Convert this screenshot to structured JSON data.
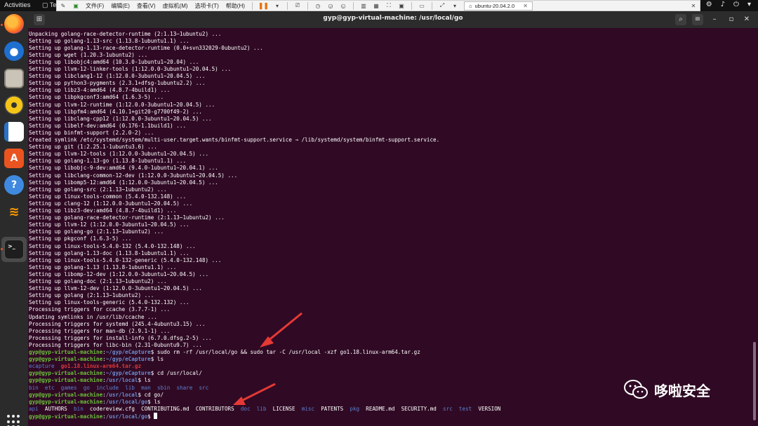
{
  "topbar": {
    "activities": "Activities",
    "terminal_tab": "Te"
  },
  "vmbar": {
    "menus": [
      "文件(F)",
      "编辑(E)",
      "查看(V)",
      "虚拟机(M)",
      "选项卡(T)",
      "帮助(H)"
    ],
    "tab_label": "ubuntu-20.04.2.0"
  },
  "terminal": {
    "title": "gyp@gyp-virtual-machine: /usr/local/go",
    "output_lines": [
      "Unpacking golang-race-detector-runtime (2:1.13~1ubuntu2) ...",
      "Setting up golang-1.13-src (1.13.8-1ubuntu1.1) ...",
      "Setting up golang-1.13-race-detector-runtime (0.0+svn332029-0ubuntu2) ...",
      "Setting up wget (1.20.3-1ubuntu2) ...",
      "Setting up libobjc4:amd64 (10.3.0-1ubuntu1~20.04) ...",
      "Setting up llvm-12-linker-tools (1:12.0.0-3ubuntu1~20.04.5) ...",
      "Setting up libclang1-12 (1:12.0.0-3ubuntu1~20.04.5) ...",
      "Setting up python3-pygments (2.3.1+dfsg-1ubuntu2.2) ...",
      "Setting up libz3-4:amd64 (4.8.7-4build1) ...",
      "Setting up libpkgconf3:amd64 (1.6.3-5) ...",
      "Setting up llvm-12-runtime (1:12.0.0-3ubuntu1~20.04.5) ...",
      "Setting up libpfm4:amd64 (4.10.1+git20-g7700f49-2) ...",
      "Setting up libclang-cpp12 (1:12.0.0-3ubuntu1~20.04.5) ...",
      "Setting up libelf-dev:amd64 (0.176-1.1build1) ...",
      "Setting up binfmt-support (2.2.0-2) ...",
      "Created symlink /etc/systemd/system/multi-user.target.wants/binfmt-support.service → /lib/systemd/system/binfmt-support.service.",
      "Setting up git (1:2.25.1-1ubuntu3.6) ...",
      "Setting up llvm-12-tools (1:12.0.0-3ubuntu1~20.04.5) ...",
      "Setting up golang-1.13-go (1.13.8-1ubuntu1.1) ...",
      "Setting up libobjc-9-dev:amd64 (9.4.0-1ubuntu1~20.04.1) ...",
      "Setting up libclang-common-12-dev (1:12.0.0-3ubuntu1~20.04.5) ...",
      "Setting up libomp5-12:amd64 (1:12.0.0-3ubuntu1~20.04.5) ...",
      "Setting up golang-src (2:1.13~1ubuntu2) ...",
      "Setting up linux-tools-common (5.4.0-132.148) ...",
      "Setting up clang-12 (1:12.0.0-3ubuntu1~20.04.5) ...",
      "Setting up libz3-dev:amd64 (4.8.7-4build1) ...",
      "Setting up golang-race-detector-runtime (2:1.13~1ubuntu2) ...",
      "Setting up llvm-12 (1:12.0.0-3ubuntu1~20.04.5) ...",
      "Setting up golang-go (2:1.13~1ubuntu2) ...",
      "Setting up pkgconf (1.6.3-5) ...",
      "Setting up linux-tools-5.4.0-132 (5.4.0-132.148) ...",
      "Setting up golang-1.13-doc (1.13.8-1ubuntu1.1) ...",
      "Setting up linux-tools-5.4.0-132-generic (5.4.0-132.148) ...",
      "Setting up golang-1.13 (1.13.8-1ubuntu1.1) ...",
      "Setting up libomp-12-dev (1:12.0.0-3ubuntu1~20.04.5) ...",
      "Setting up golang-doc (2:1.13~1ubuntu2) ...",
      "Setting up llvm-12-dev (1:12.0.0-3ubuntu1~20.04.5) ...",
      "Setting up golang (2:1.13~1ubuntu2) ...",
      "Setting up linux-tools-generic (5.4.0-132.132) ...",
      "Processing triggers for ccache (3.7.7-1) ...",
      "Updating symlinks in /usr/lib/ccache ...",
      "Processing triggers for systemd (245.4-4ubuntu3.15) ...",
      "Processing triggers for man-db (2.9.1-1) ...",
      "Processing triggers for install-info (6.7.0.dfsg.2-5) ...",
      "Processing triggers for libc-bin (2.31-0ubuntu9.7) ..."
    ],
    "session": {
      "user_host": "gyp@gyp-virtual-machine",
      "path_ecapture": "~/gyp/eCapture",
      "path_local": "/usr/local",
      "path_go": "/usr/local/go",
      "cmd1": "sudo rm -rf /usr/local/go && sudo tar -C /usr/local -xzf go1.18.linux-arm64.tar.gz",
      "cmd2": "ls",
      "ls1_dir": "ecapture",
      "ls1_archive": "go1.18.linux-arm64.tar.gz",
      "cmd3": "cd /usr/local/",
      "cmd4": "ls",
      "ls2": [
        "bin",
        "etc",
        "games",
        "go",
        "include",
        "lib",
        "man",
        "sbin",
        "share",
        "src"
      ],
      "cmd5": "cd go/",
      "cmd6": "ls",
      "ls3": [
        {
          "name": "api",
          "dir": true
        },
        {
          "name": "AUTHORS",
          "dir": false
        },
        {
          "name": "bin",
          "dir": true
        },
        {
          "name": "codereview.cfg",
          "dir": false
        },
        {
          "name": "CONTRIBUTING.md",
          "dir": false
        },
        {
          "name": "CONTRIBUTORS",
          "dir": false
        },
        {
          "name": "doc",
          "dir": true
        },
        {
          "name": "lib",
          "dir": true
        },
        {
          "name": "LICENSE",
          "dir": false
        },
        {
          "name": "misc",
          "dir": true
        },
        {
          "name": "PATENTS",
          "dir": false
        },
        {
          "name": "pkg",
          "dir": true
        },
        {
          "name": "README.md",
          "dir": false
        },
        {
          "name": "SECURITY.md",
          "dir": false
        },
        {
          "name": "src",
          "dir": true
        },
        {
          "name": "test",
          "dir": true
        },
        {
          "name": "VERSION",
          "dir": false
        }
      ]
    }
  },
  "dock": {
    "icons": [
      "firefox-icon",
      "thunderbird-icon",
      "files-icon",
      "rhythmbox-icon",
      "libreoffice-writer-icon",
      "ubuntu-software-icon",
      "help-icon",
      "sublime-text-icon",
      "terminal-icon",
      "show-applications-icon"
    ]
  },
  "watermark": {
    "text": "哆啦安全"
  },
  "colors": {
    "terminal_bg": "#300a24",
    "prompt_user": "#6ac33b",
    "prompt_path": "#6a8fd0",
    "archive_red": "#d83a3a",
    "arrow_red": "#e53935"
  }
}
